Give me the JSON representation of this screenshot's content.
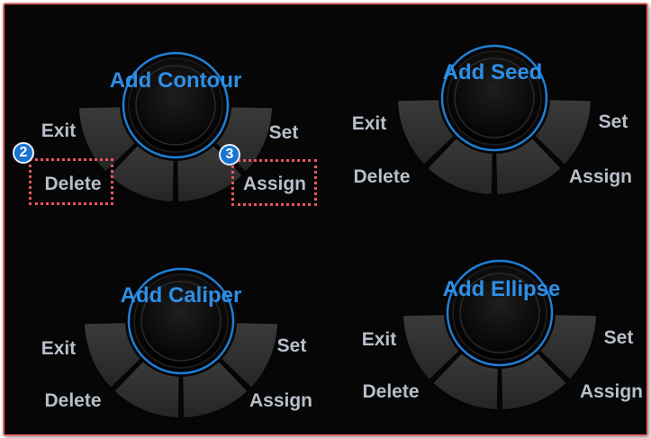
{
  "colors": {
    "accent": "#2d8fe6",
    "label": "#b7bfc9",
    "highlight": "#e8555f",
    "badge": "#1874d0"
  },
  "menus": [
    {
      "title": "Add Contour",
      "exit": "Exit",
      "set": "Set",
      "delete": "Delete",
      "assign": "Assign"
    },
    {
      "title": "Add Seed",
      "exit": "Exit",
      "set": "Set",
      "delete": "Delete",
      "assign": "Assign"
    },
    {
      "title": "Add Caliper",
      "exit": "Exit",
      "set": "Set",
      "delete": "Delete",
      "assign": "Assign"
    },
    {
      "title": "Add Ellipse",
      "exit": "Exit",
      "set": "Set",
      "delete": "Delete",
      "assign": "Assign"
    }
  ],
  "callouts": [
    {
      "number": "2",
      "target": "Delete"
    },
    {
      "number": "3",
      "target": "Assign"
    }
  ]
}
